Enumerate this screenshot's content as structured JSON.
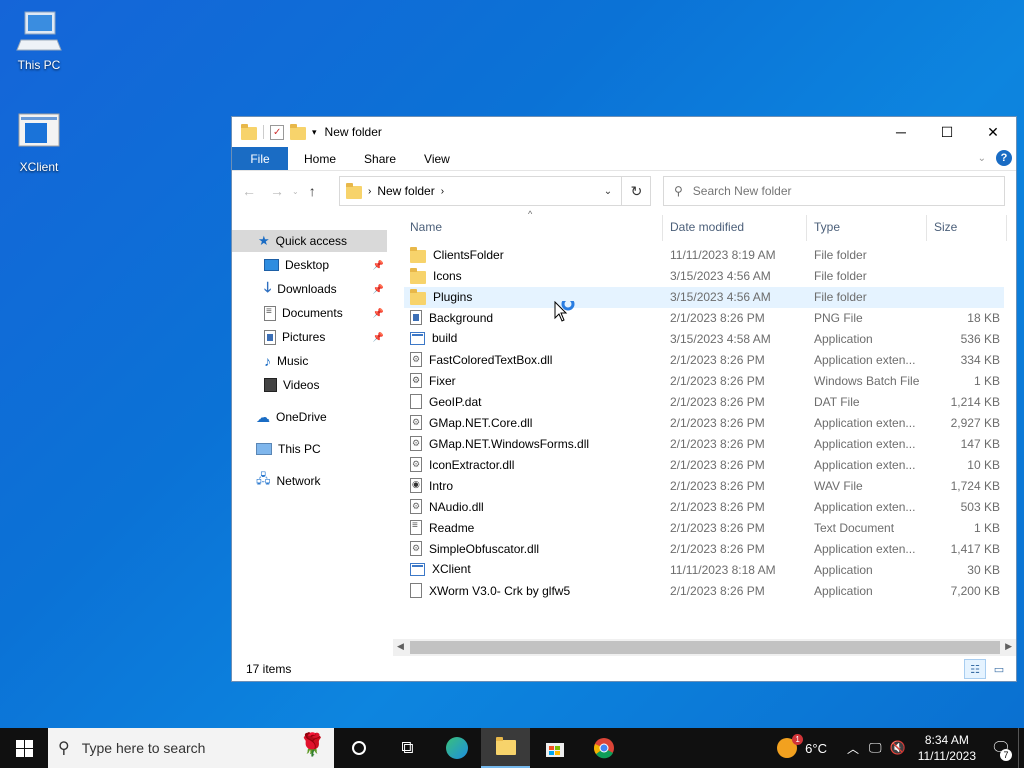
{
  "desktop": {
    "icons": [
      {
        "label": "This PC"
      },
      {
        "label": "XClient"
      }
    ]
  },
  "window": {
    "title": "New folder",
    "ribbon_tabs": [
      "File",
      "Home",
      "Share",
      "View"
    ],
    "address": {
      "crumb": "New folder"
    },
    "search": {
      "placeholder": "Search New folder"
    },
    "nav": {
      "quick_access": "Quick access",
      "items": [
        {
          "label": "Desktop",
          "icon": "desktop-icon",
          "pinned": true
        },
        {
          "label": "Downloads",
          "icon": "downloads-icon",
          "pinned": true
        },
        {
          "label": "Documents",
          "icon": "documents-icon",
          "pinned": true
        },
        {
          "label": "Pictures",
          "icon": "pictures-icon",
          "pinned": true
        },
        {
          "label": "Music",
          "icon": "music-icon",
          "pinned": false
        },
        {
          "label": "Videos",
          "icon": "videos-icon",
          "pinned": false
        }
      ],
      "onedrive": "OneDrive",
      "thispc": "This PC",
      "network": "Network"
    },
    "columns": {
      "name": "Name",
      "date": "Date modified",
      "type": "Type",
      "size": "Size"
    },
    "files": [
      {
        "name": "ClientsFolder",
        "date": "11/11/2023 8:19 AM",
        "type": "File folder",
        "size": "",
        "icon": "folder"
      },
      {
        "name": "Icons",
        "date": "3/15/2023 4:56 AM",
        "type": "File folder",
        "size": "",
        "icon": "folder"
      },
      {
        "name": "Plugins",
        "date": "3/15/2023 4:56 AM",
        "type": "File folder",
        "size": "",
        "icon": "folder"
      },
      {
        "name": "Background",
        "date": "2/1/2023 8:26 PM",
        "type": "PNG File",
        "size": "18 KB",
        "icon": "img"
      },
      {
        "name": "build",
        "date": "3/15/2023 4:58 AM",
        "type": "Application",
        "size": "536 KB",
        "icon": "app"
      },
      {
        "name": "FastColoredTextBox.dll",
        "date": "2/1/2023 8:26 PM",
        "type": "Application exten...",
        "size": "334 KB",
        "icon": "dll"
      },
      {
        "name": "Fixer",
        "date": "2/1/2023 8:26 PM",
        "type": "Windows Batch File",
        "size": "1 KB",
        "icon": "bat"
      },
      {
        "name": "GeoIP.dat",
        "date": "2/1/2023 8:26 PM",
        "type": "DAT File",
        "size": "1,214 KB",
        "icon": "file"
      },
      {
        "name": "GMap.NET.Core.dll",
        "date": "2/1/2023 8:26 PM",
        "type": "Application exten...",
        "size": "2,927 KB",
        "icon": "dll"
      },
      {
        "name": "GMap.NET.WindowsForms.dll",
        "date": "2/1/2023 8:26 PM",
        "type": "Application exten...",
        "size": "147 KB",
        "icon": "dll"
      },
      {
        "name": "IconExtractor.dll",
        "date": "2/1/2023 8:26 PM",
        "type": "Application exten...",
        "size": "10 KB",
        "icon": "dll"
      },
      {
        "name": "Intro",
        "date": "2/1/2023 8:26 PM",
        "type": "WAV File",
        "size": "1,724 KB",
        "icon": "wav"
      },
      {
        "name": "NAudio.dll",
        "date": "2/1/2023 8:26 PM",
        "type": "Application exten...",
        "size": "503 KB",
        "icon": "dll"
      },
      {
        "name": "Readme",
        "date": "2/1/2023 8:26 PM",
        "type": "Text Document",
        "size": "1 KB",
        "icon": "txt"
      },
      {
        "name": "SimpleObfuscator.dll",
        "date": "2/1/2023 8:26 PM",
        "type": "Application exten...",
        "size": "1,417 KB",
        "icon": "dll"
      },
      {
        "name": "XClient",
        "date": "11/11/2023 8:18 AM",
        "type": "Application",
        "size": "30 KB",
        "icon": "app"
      },
      {
        "name": "XWorm V3.0- Crk by glfw5",
        "date": "2/1/2023 8:26 PM",
        "type": "Application",
        "size": "7,200 KB",
        "icon": "file"
      }
    ],
    "status": "17 items"
  },
  "taskbar": {
    "search_placeholder": "Type here to search",
    "weather": "6°C",
    "weather_badge": "1",
    "time": "8:34 AM",
    "date": "11/11/2023",
    "notifications": "7"
  },
  "colors": {
    "accent": "#1a6cc4",
    "selection": "#e5f3ff",
    "taskbar": "#101010"
  }
}
